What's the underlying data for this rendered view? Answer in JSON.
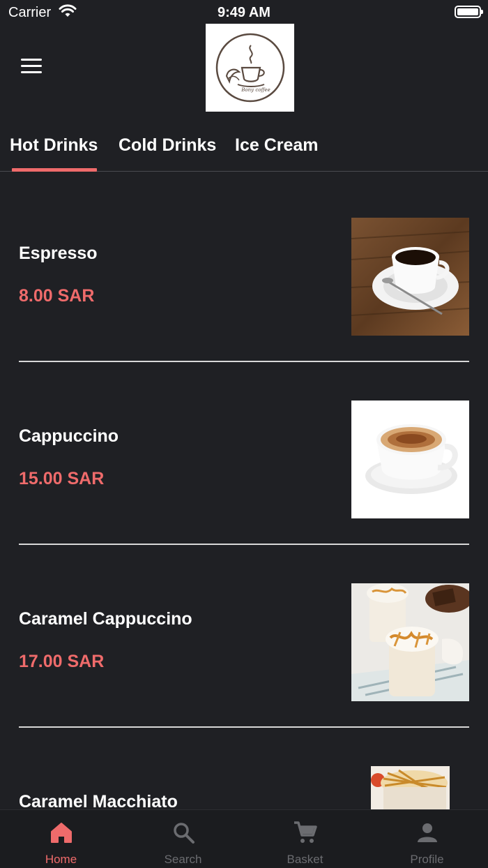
{
  "status_bar": {
    "carrier": "Carrier",
    "time": "9:49 AM"
  },
  "header": {
    "logo_icon": "coffee-cup-logo",
    "logo_text": "Bony coffee",
    "menu_icon": "hamburger-icon"
  },
  "tabs": [
    {
      "label": "Hot Drinks",
      "active": true
    },
    {
      "label": "Cold Drinks",
      "active": false
    },
    {
      "label": "Ice Cream",
      "active": false
    }
  ],
  "products": [
    {
      "name": "Espresso",
      "price": "8.00 SAR",
      "image": "espresso-cup-photo"
    },
    {
      "name": "Cappuccino",
      "price": "15.00 SAR",
      "image": "cappuccino-cup-photo"
    },
    {
      "name": "Caramel Cappuccino",
      "price": "17.00 SAR",
      "image": "caramel-cappuccino-photo"
    },
    {
      "name": "Caramel Macchiato",
      "price": "",
      "image": "caramel-macchiato-photo"
    }
  ],
  "bottom_nav": [
    {
      "label": "Home",
      "icon": "home-icon",
      "active": true
    },
    {
      "label": "Search",
      "icon": "search-icon",
      "active": false
    },
    {
      "label": "Basket",
      "icon": "cart-icon",
      "active": false
    },
    {
      "label": "Profile",
      "icon": "person-icon",
      "active": false
    }
  ],
  "colors": {
    "accent": "#ef6b6b",
    "background": "#1f2024",
    "nav_inactive": "#6b6c70"
  }
}
